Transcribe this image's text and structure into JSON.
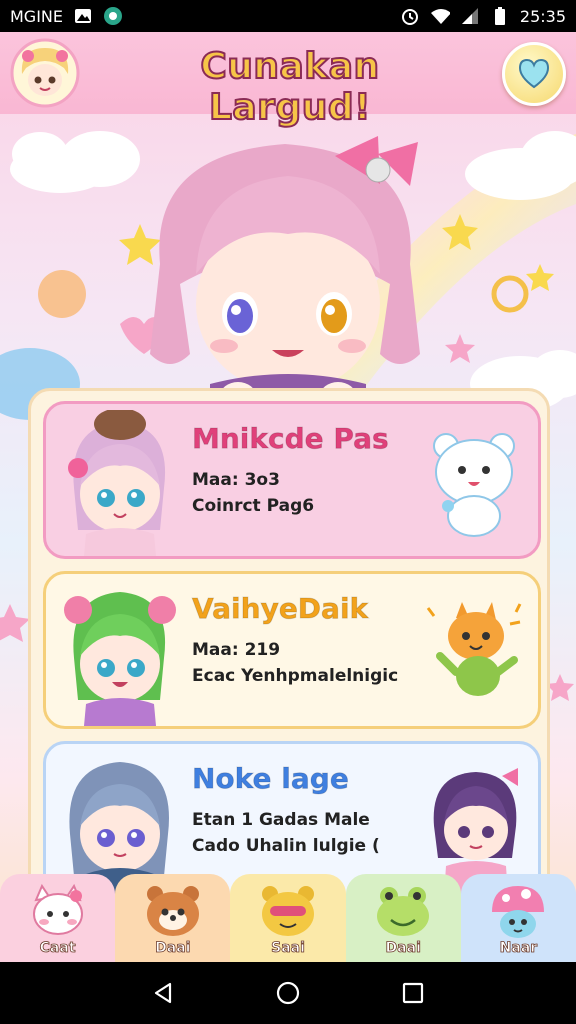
{
  "status_bar": {
    "carrier": "MGINE",
    "time": "25:35"
  },
  "header": {
    "title": "Cunakan Largud!"
  },
  "cards": [
    {
      "title": "Mnikcde Pas",
      "line1": "Maa: 3o3",
      "line2": "Coinrct Pag6",
      "title_color": "#e0407a",
      "bg": "#f9cfe3",
      "border": "#f29bc2"
    },
    {
      "title": "VaihyeDaik",
      "line1": "Maa: 219",
      "line2": "Ecac Yenhpmalelnigic",
      "title_color": "#f2a21b",
      "bg": "#fff8e6",
      "border": "#f5cf7a"
    },
    {
      "title": "Noke lage",
      "line1": "Etan 1 Gadas Male",
      "line2": "Cado Uhalin lulgie (",
      "title_color": "#3f7fe0",
      "bg": "#f2f7ff",
      "border": "#b9d4f5"
    }
  ],
  "tabs": [
    {
      "label": "Caat",
      "icon": "white-kitty-icon",
      "bg": "#fbd0df"
    },
    {
      "label": "Daai",
      "icon": "brown-bear-icon",
      "bg": "#fcd9b0"
    },
    {
      "label": "Saai",
      "icon": "yellow-bear-icon",
      "bg": "#fbe9a9"
    },
    {
      "label": "Daai",
      "icon": "green-frog-icon",
      "bg": "#d8f0c5"
    },
    {
      "label": "Naar",
      "icon": "mushroom-icon",
      "bg": "#cfe3fa"
    }
  ]
}
